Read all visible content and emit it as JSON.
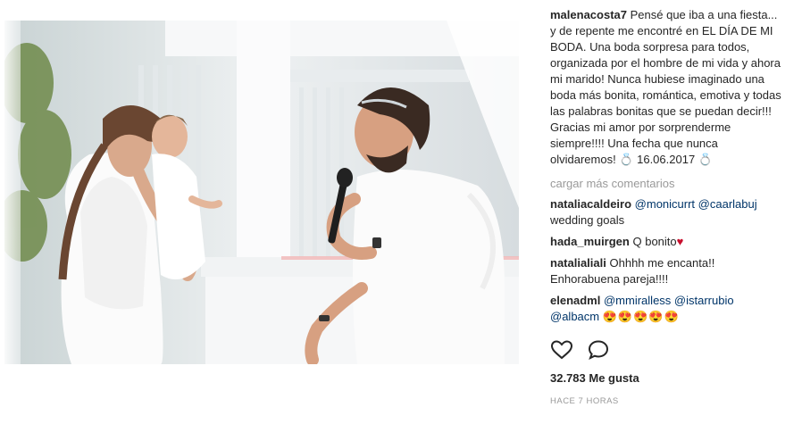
{
  "photo": {
    "alt_colors": {
      "wall": "#f4f5f6",
      "shirt": "#fbfbfb",
      "hair": "#6a4631",
      "skin": "#d9a98c"
    }
  },
  "post": {
    "author": "malenacosta7",
    "caption_part1": "Pensé que iba a una fiesta... y de repente me encontré en EL DÍA DE MI BODA. Una boda sorpresa para todos, organizada por el hombre de mi vida y ahora mi marido! Nunca hubiese imaginado una boda más bonita, romántica, emotiva y todas las palabras bonitas que se puedan decir!!! Gracias mi amor por sorprenderme siempre!!!! Una fecha que nunca olvidaremos! ",
    "ring_emoji": "💍",
    "date_text": " 16.06.2017 "
  },
  "comments": {
    "load_more": "cargar más comentarios",
    "items": [
      {
        "user": "nataliacaldeiro",
        "mention1": "@monicurrt",
        "mention2": "@caarlabuj",
        "text": "wedding goals"
      },
      {
        "user": "hada_muirgen",
        "text": "Q bonito",
        "heart": "♥"
      },
      {
        "user": "natalialiali",
        "text": "Ohhhh me encanta!! Enhorabuena pareja!!!!"
      },
      {
        "user": "elenadml",
        "mention1": "@mmiralless",
        "mention2": "@istarrubio",
        "mention3": "@albacm",
        "emojis": "😍😍😍😍😍"
      }
    ]
  },
  "actions": {
    "like_icon": "heart-outline-icon",
    "comment_icon": "speech-bubble-icon"
  },
  "likes_text": "32.783 Me gusta",
  "time_text": "HACE 7 HORAS"
}
